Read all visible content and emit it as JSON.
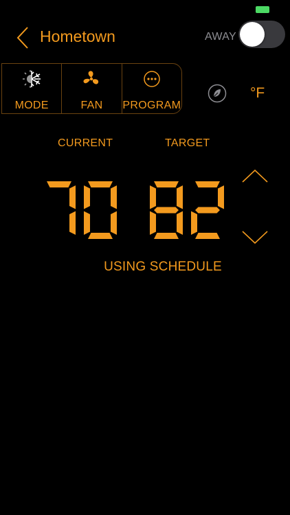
{
  "status": {
    "battery_color": "#4cd964"
  },
  "header": {
    "title": "Hometown",
    "away_label": "AWAY",
    "away_enabled": false
  },
  "modes": [
    {
      "id": "mode",
      "label": "MODE",
      "icon": "snowflake-sun-icon"
    },
    {
      "id": "fan",
      "label": "FAN",
      "icon": "fan-icon"
    },
    {
      "id": "program",
      "label": "PROGRAM",
      "icon": "more-dots-icon"
    }
  ],
  "controls": {
    "eco_icon": "leaf-icon",
    "unit": "°F"
  },
  "temperature": {
    "current_label": "CURRENT",
    "target_label": "TARGET",
    "current": "70",
    "target": "82",
    "status": "USING SCHEDULE"
  },
  "colors": {
    "accent": "#f39a1e",
    "background": "#000000",
    "muted": "#8e8e93"
  }
}
